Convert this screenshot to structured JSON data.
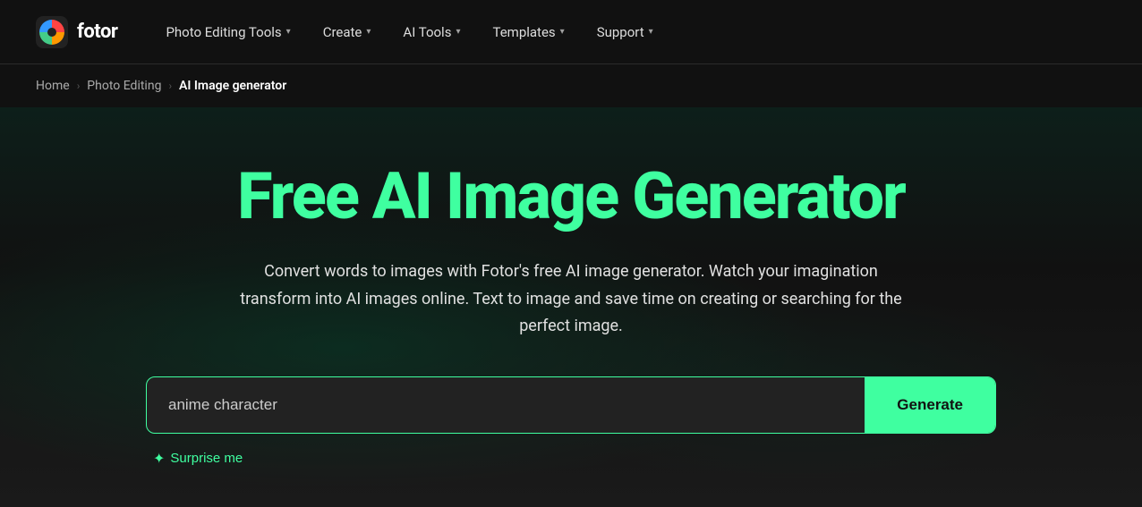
{
  "logo": {
    "text": "fotor"
  },
  "nav": {
    "items": [
      {
        "label": "Photo Editing Tools",
        "has_dropdown": true
      },
      {
        "label": "Create",
        "has_dropdown": true
      },
      {
        "label": "AI Tools",
        "has_dropdown": true
      },
      {
        "label": "Templates",
        "has_dropdown": true
      },
      {
        "label": "Support",
        "has_dropdown": true
      }
    ]
  },
  "breadcrumb": {
    "items": [
      {
        "label": "Home",
        "active": false
      },
      {
        "label": "Photo Editing",
        "active": false
      },
      {
        "label": "AI Image generator",
        "active": true
      }
    ]
  },
  "hero": {
    "title": "Free AI Image Generator",
    "subtitle": "Convert words to images with Fotor's free AI image generator. Watch your imagination transform into AI images online. Text to image and save time on creating or searching for the perfect image."
  },
  "search": {
    "placeholder": "anime character",
    "input_value": "anime character",
    "generate_label": "Generate",
    "surprise_label": "Surprise me"
  },
  "colors": {
    "accent": "#3fffa0",
    "nav_bg": "#111111",
    "body_bg": "#1a1a1a"
  }
}
